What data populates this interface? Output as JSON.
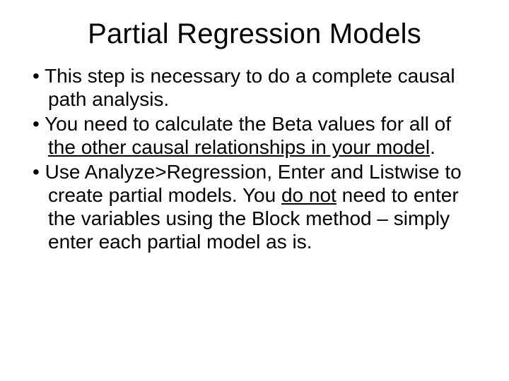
{
  "title": "Partial Regression Models",
  "bullets": [
    {
      "pre": "This step is necessary to do a complete causal path analysis.",
      "u1": "",
      "mid": "",
      "u2": "",
      "post": ""
    },
    {
      "pre": "You need to calculate the Beta values for all of ",
      "u1": "the other causal relationships in your model",
      "mid": ".",
      "u2": "",
      "post": ""
    },
    {
      "pre": "Use Analyze>Regression, Enter and Listwise to create partial models. You ",
      "u1": "do not",
      "mid": " need to enter the variables using the Block method – simply enter each partial model as is.",
      "u2": "",
      "post": ""
    }
  ]
}
